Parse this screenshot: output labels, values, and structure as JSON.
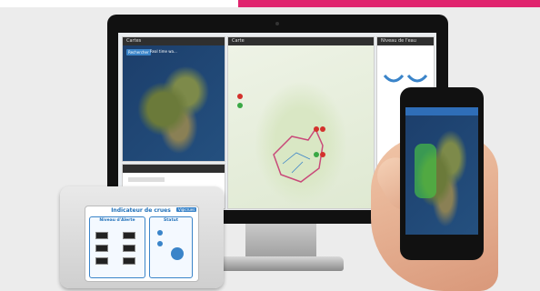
{
  "screen": {
    "map_panel_title": "Cartes",
    "search_button": "Rechercher",
    "search_placeholder": "Real time wa...",
    "overview_panel_title": "Carte",
    "right_panel_title": "Niveau de l'eau"
  },
  "device": {
    "title": "Indicateur de crues",
    "brand": "Vigicrues",
    "left_box_title": "Niveau d'Alerte",
    "right_box_title": "Statut"
  },
  "colors": {
    "accent": "#e0246e",
    "ui_blue": "#3a84c9",
    "pin_red": "#d3312c",
    "pin_green": "#3aa845",
    "flood_area": "#c94a7a"
  }
}
